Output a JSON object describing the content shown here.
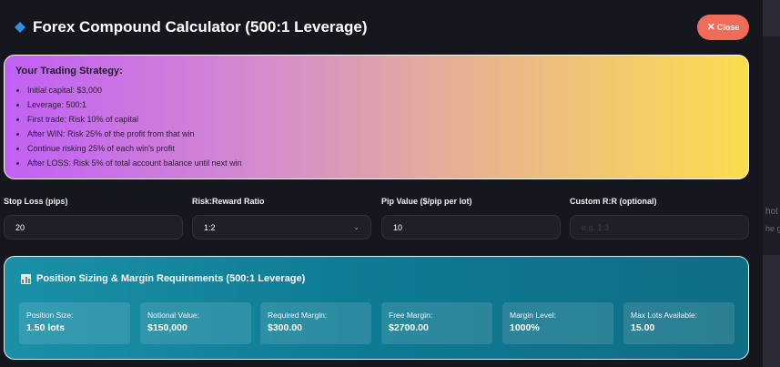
{
  "modal": {
    "title": "Forex Compound Calculator (500:1 Leverage)",
    "close_label": "Close"
  },
  "strategy": {
    "title": "Your Trading Strategy:",
    "items": [
      "Initial capital: $3,000",
      "Leverage: 500:1",
      "First trade: Risk 10% of capital",
      "After WIN: Risk 25% of the profit from that win",
      "Continue risking 25% of each win's profit",
      "After LOSS: Risk 5% of total account balance until next win"
    ]
  },
  "fields": {
    "stop_loss": {
      "label": "Stop Loss (pips)",
      "value": "20"
    },
    "risk_reward": {
      "label": "Risk:Reward Ratio",
      "value": "1:2"
    },
    "pip_value": {
      "label": "Pip Value ($/pip per lot)",
      "value": "10"
    },
    "custom_rr": {
      "label": "Custom R:R (optional)",
      "placeholder": "e.g. 1:3"
    }
  },
  "position": {
    "title": "Position Sizing & Margin Requirements (500:1 Leverage)",
    "metrics": [
      {
        "label": "Position Size:",
        "value": "1.50 lots"
      },
      {
        "label": "Notional Value:",
        "value": "$150,000"
      },
      {
        "label": "Required Margin:",
        "value": "$300.00"
      },
      {
        "label": "Free Margin:",
        "value": "$2700.00"
      },
      {
        "label": "Margin Level:",
        "value": "1000%"
      },
      {
        "label": "Max Lots Available:",
        "value": "15.00"
      }
    ]
  },
  "background": {
    "text_1": "hot",
    "text_2": "he g"
  },
  "colors": {
    "close_button": "#f06b59",
    "diamond_icon": "#2f8fe8",
    "panel_teal": "#0e7a93",
    "gradient_start": "#c160f5",
    "gradient_end": "#fbdd4e"
  },
  "icons": {
    "title_icon": "blue-diamond-icon",
    "close_icon": "close-icon",
    "panel_icon": "bar-chart-icon",
    "select_icon": "chevron-down-icon"
  }
}
